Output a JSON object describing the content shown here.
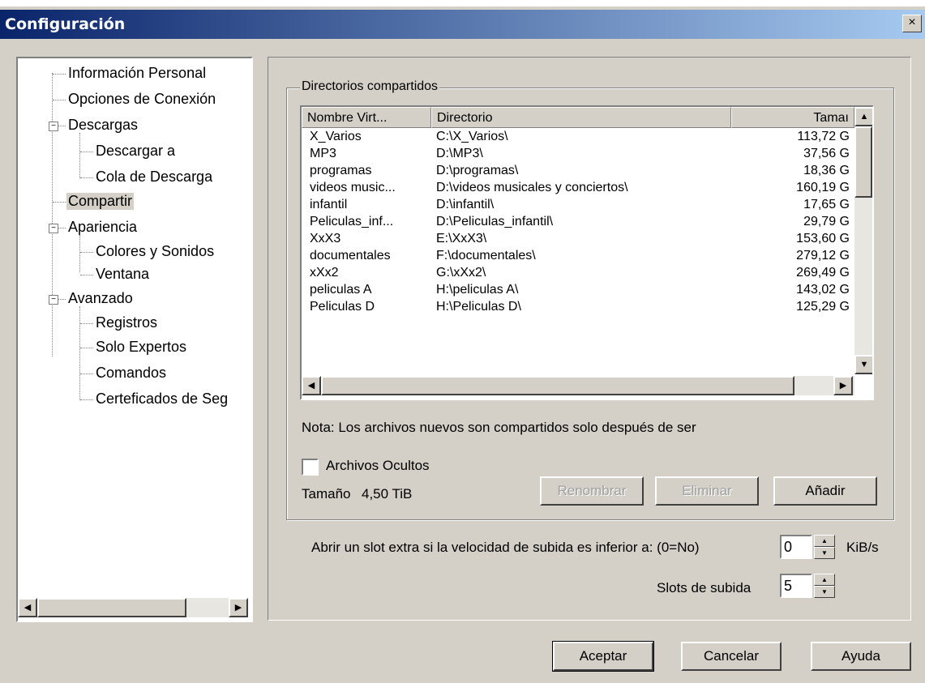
{
  "window": {
    "title": "Configuración",
    "close_symbol": "×"
  },
  "tree": {
    "items": [
      {
        "label": "Información Personal"
      },
      {
        "label": "Opciones de Conexión"
      },
      {
        "label": "Descargas"
      },
      {
        "label": "Descargar a"
      },
      {
        "label": "Cola de Descarga"
      },
      {
        "label": "Compartir"
      },
      {
        "label": "Apariencia"
      },
      {
        "label": "Colores y Sonidos"
      },
      {
        "label": "Ventana"
      },
      {
        "label": "Avanzado"
      },
      {
        "label": "Registros"
      },
      {
        "label": "Solo Expertos"
      },
      {
        "label": "Comandos"
      },
      {
        "label": "Certeficados de Seg"
      }
    ],
    "expander_symbol": "−"
  },
  "shared": {
    "group_label": "Directorios compartidos",
    "columns": [
      "Nombre Virt...",
      "Directorio",
      "Tamaı"
    ],
    "rows": [
      [
        "X_Varios",
        "C:\\X_Varios\\",
        "113,72 G"
      ],
      [
        "MP3",
        "D:\\MP3\\",
        "37,56 G"
      ],
      [
        "programas",
        "D:\\programas\\",
        "18,36 G"
      ],
      [
        "videos music...",
        "D:\\videos musicales y conciertos\\",
        "160,19 G"
      ],
      [
        "infantil",
        "D:\\infantil\\",
        "17,65 G"
      ],
      [
        "Peliculas_inf...",
        "D:\\Peliculas_infantil\\",
        "29,79 G"
      ],
      [
        "XxX3",
        "E:\\XxX3\\",
        "153,60 G"
      ],
      [
        "documentales",
        "F:\\documentales\\",
        "279,12 G"
      ],
      [
        "xXx2",
        "G:\\xXx2\\",
        "269,49 G"
      ],
      [
        "peliculas A",
        "H:\\peliculas A\\",
        "143,02 G"
      ],
      [
        "Peliculas D",
        "H:\\Peliculas D\\",
        "125,29 G"
      ]
    ],
    "note": "Nota: Los archivos nuevos son compartidos solo después de ser",
    "hidden_files_label": "Archivos Ocultos",
    "hidden_files_checked": false,
    "size_label": "Tamaño",
    "size_value": "4,50 TiB",
    "rename_label": "Renombrar",
    "remove_label": "Eliminar",
    "add_label": "Añadir"
  },
  "slots": {
    "extra_slot_label": "Abrir un slot extra si la velocidad de subida es inferior a: (0=No)",
    "extra_slot_value": "0",
    "extra_slot_unit": "KiB/s",
    "upload_slots_label": "Slots de subida",
    "upload_slots_value": "5"
  },
  "footer": {
    "ok_label": "Aceptar",
    "cancel_label": "Cancelar",
    "help_label": "Ayuda"
  },
  "scroll": {
    "up": "▲",
    "down": "▼",
    "left": "◀",
    "right": "▶",
    "spin_up": "▲",
    "spin_down": "▼"
  },
  "colors": {
    "titlebar_start": "#0a246a",
    "titlebar_end": "#a6caf0",
    "face": "#d4d0c8"
  }
}
